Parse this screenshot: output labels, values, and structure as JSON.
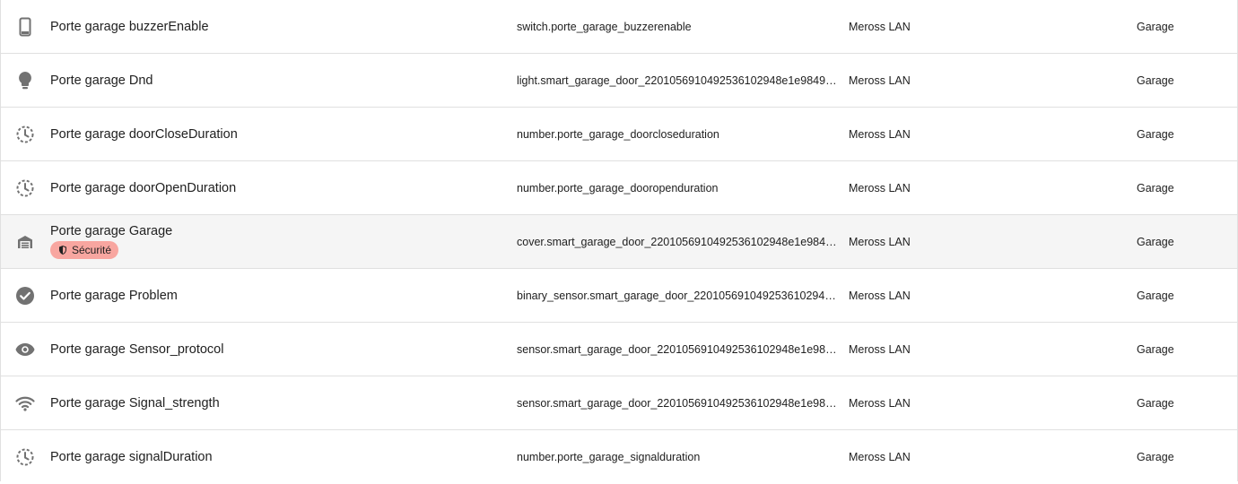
{
  "rows": [
    {
      "icon": "cellphone-icon",
      "name": "Porte garage buzzerEnable",
      "entity_id": "switch.porte_garage_buzzerenable",
      "integration": "Meross LAN",
      "area": "Garage"
    },
    {
      "icon": "lightbulb-icon",
      "name": "Porte garage Dnd",
      "entity_id": "light.smart_garage_door_2201056910492536102948e1e98494…",
      "integration": "Meross LAN",
      "area": "Garage"
    },
    {
      "icon": "clock-dashed-icon",
      "name": "Porte garage doorCloseDuration",
      "entity_id": "number.porte_garage_doorcloseduration",
      "integration": "Meross LAN",
      "area": "Garage"
    },
    {
      "icon": "clock-dashed-icon",
      "name": "Porte garage doorOpenDuration",
      "entity_id": "number.porte_garage_dooropenduration",
      "integration": "Meross LAN",
      "area": "Garage"
    },
    {
      "icon": "garage-icon",
      "name": "Porte garage Garage",
      "badge": "Sécurité",
      "entity_id": "cover.smart_garage_door_2201056910492536102948e1e98494…",
      "integration": "Meross LAN",
      "area": "Garage"
    },
    {
      "icon": "check-circle-icon",
      "name": "Porte garage Problem",
      "entity_id": "binary_sensor.smart_garage_door_2201056910492536102948e…",
      "integration": "Meross LAN",
      "area": "Garage"
    },
    {
      "icon": "eye-icon",
      "name": "Porte garage Sensor_protocol",
      "entity_id": "sensor.smart_garage_door_2201056910492536102948e1e9849…",
      "integration": "Meross LAN",
      "area": "Garage"
    },
    {
      "icon": "wifi-icon",
      "name": "Porte garage Signal_strength",
      "entity_id": "sensor.smart_garage_door_2201056910492536102948e1e9849…",
      "integration": "Meross LAN",
      "area": "Garage"
    },
    {
      "icon": "clock-dashed-icon",
      "name": "Porte garage signalDuration",
      "entity_id": "number.porte_garage_signalduration",
      "integration": "Meross LAN",
      "area": "Garage"
    }
  ],
  "colors": {
    "icon": "#727272",
    "badge_bg": "#f8a6a0",
    "highlight_row": "#f5f5f5",
    "divider": "#e0e0e0"
  }
}
